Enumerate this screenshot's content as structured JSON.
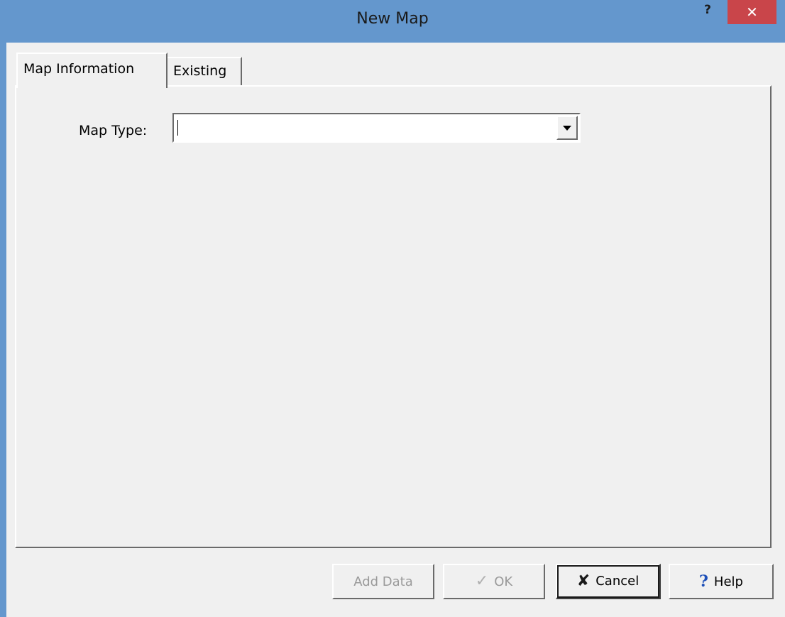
{
  "window": {
    "title": "New Map",
    "help_glyph": "?",
    "close_glyph": "✕"
  },
  "tabs": [
    {
      "label": "Map Information",
      "active": true
    },
    {
      "label": "Existing",
      "active": false
    }
  ],
  "form": {
    "map_type_label": "Map Type:",
    "map_type_value": ""
  },
  "buttons": {
    "add_data": "Add Data",
    "ok": "OK",
    "cancel": "Cancel",
    "help": "Help"
  },
  "icons": {
    "ok": "check-icon",
    "cancel": "x-icon",
    "help": "question-icon"
  },
  "colors": {
    "titlebar": "#6497cd",
    "close_button": "#c9454a",
    "dialog_background": "#f0f0f0",
    "help_icon": "#1d4fb8"
  }
}
